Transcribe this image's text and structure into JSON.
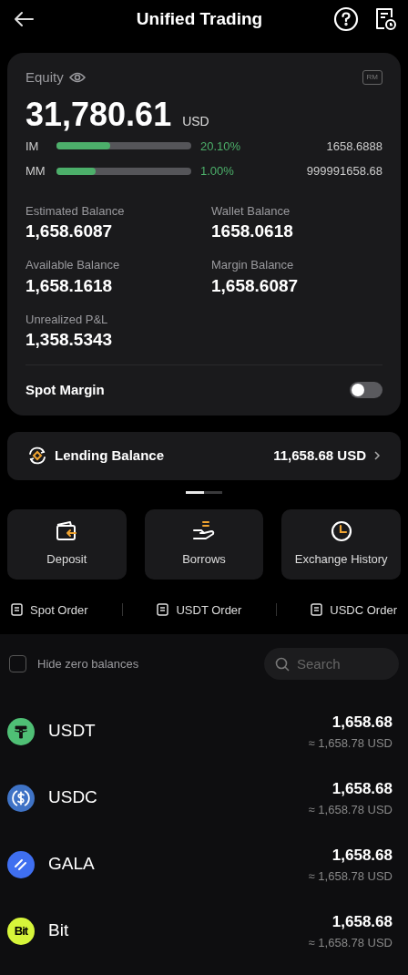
{
  "header": {
    "title": "Unified Trading"
  },
  "equity": {
    "label": "Equity",
    "badge": "RM",
    "amount": "31,780.61",
    "currency": "USD",
    "margins": [
      {
        "label": "IM",
        "level": 0.4,
        "percent": "20.10%",
        "value": "1658.6888"
      },
      {
        "label": "MM",
        "level": 0.29,
        "percent": "1.00%",
        "value": "999991658.68"
      }
    ],
    "balances": [
      {
        "label": "Estimated Balance",
        "value": "1,658.6087"
      },
      {
        "label": "Wallet Balance",
        "value": "1658.0618"
      },
      {
        "label": "Available Balance",
        "value": "1,658.1618"
      },
      {
        "label": "Margin Balance",
        "value": "1,658.6087"
      },
      {
        "label": "Unrealized P&L",
        "value": "1,358.5343"
      }
    ],
    "spot_margin": {
      "label": "Spot Margin",
      "on": false
    }
  },
  "lending": {
    "label": "Lending Balance",
    "value": "11,658.68 USD"
  },
  "pager": [
    {
      "selected": true
    },
    {
      "selected": false
    }
  ],
  "actions": [
    {
      "kind": "deposit",
      "label": "Deposit"
    },
    {
      "kind": "borrows",
      "label": "Borrows"
    },
    {
      "kind": "history",
      "label": "Exchange History"
    }
  ],
  "orders": [
    "Spot Order",
    "USDT Order",
    "USDC Order"
  ],
  "filter": {
    "hide_zero": {
      "label": "Hide zero balances",
      "checked": false
    },
    "search": {
      "placeholder": "Search"
    }
  },
  "assets": [
    {
      "kind": "tether",
      "color": "#4fbf75",
      "name": "USDT",
      "amount": "1,658.68",
      "usd": "≈ 1,658.78 USD"
    },
    {
      "kind": "usdc",
      "color": "#3f73c6",
      "name": "USDC",
      "amount": "1,658.68",
      "usd": "≈ 1,658.78 USD"
    },
    {
      "kind": "gala",
      "color": "#3f6ff0",
      "name": "GALA",
      "amount": "1,658.68",
      "usd": "≈ 1,658.78 USD"
    },
    {
      "kind": "bit",
      "color": "#d6f53a",
      "logo_text": "Bit",
      "name": "Bit",
      "amount": "1,658.68",
      "usd": "≈ 1,658.78 USD"
    }
  ]
}
